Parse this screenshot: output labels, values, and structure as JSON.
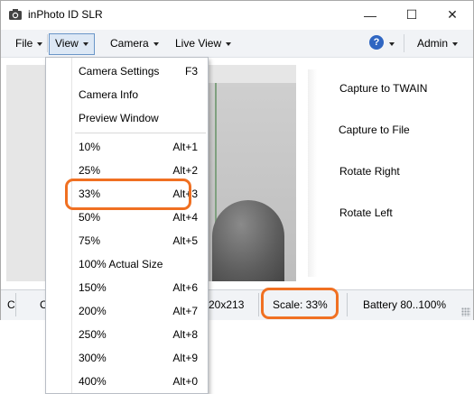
{
  "window": {
    "title": "inPhoto ID SLR",
    "minimize_glyph": "—",
    "maximize_glyph": "☐",
    "close_glyph": "✕"
  },
  "menubar": {
    "file": "File",
    "view": "View",
    "camera": "Camera",
    "live_view": "Live View",
    "help_glyph": "?",
    "admin": "Admin"
  },
  "actions": {
    "capture_twain": "Capture to TWAIN",
    "capture_file": "Capture to File",
    "rotate_right": "Rotate Right",
    "rotate_left": "Rotate Left"
  },
  "statusbar": {
    "cell0": "C",
    "cell1": "C",
    "resolution_fragment": "20x213",
    "scale": "Scale: 33%",
    "battery": "Battery 80..100%"
  },
  "view_menu": {
    "items": [
      {
        "label": "Camera Settings",
        "shortcut": "F3"
      },
      {
        "label": "Camera Info",
        "shortcut": ""
      },
      {
        "label": "Preview Window",
        "shortcut": ""
      },
      {
        "label": "10%",
        "shortcut": "Alt+1"
      },
      {
        "label": "25%",
        "shortcut": "Alt+2"
      },
      {
        "label": "33%",
        "shortcut": "Alt+3"
      },
      {
        "label": "50%",
        "shortcut": "Alt+4"
      },
      {
        "label": "75%",
        "shortcut": "Alt+5"
      },
      {
        "label": "100% Actual Size",
        "shortcut": ""
      },
      {
        "label": "150%",
        "shortcut": "Alt+6"
      },
      {
        "label": "200%",
        "shortcut": "Alt+7"
      },
      {
        "label": "250%",
        "shortcut": "Alt+8"
      },
      {
        "label": "300%",
        "shortcut": "Alt+9"
      },
      {
        "label": "400%",
        "shortcut": "Alt+0"
      }
    ]
  },
  "colors": {
    "highlight": "#f07022",
    "menu_active": "#dde8f5",
    "help": "#2f66c2"
  }
}
